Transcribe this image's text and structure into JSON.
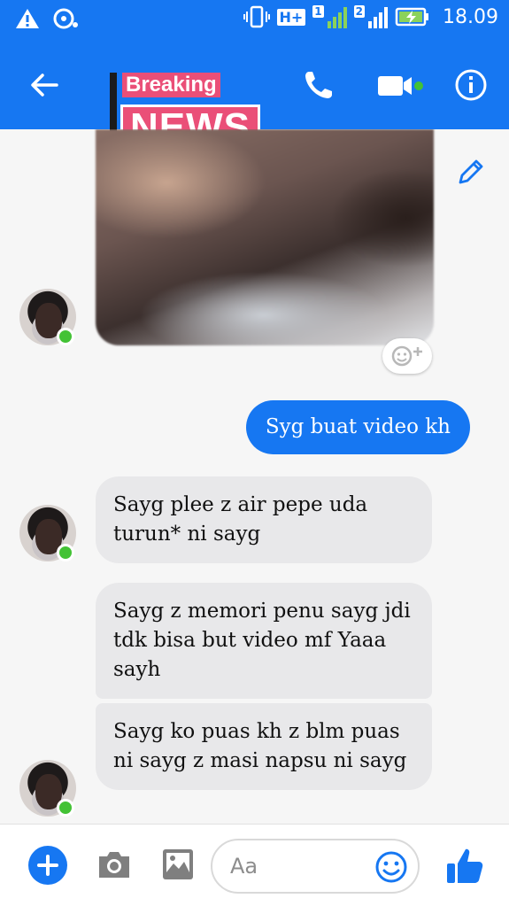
{
  "status_bar": {
    "network_badge": "H+",
    "sim1": "1",
    "sim2": "2",
    "time": "18.09"
  },
  "header": {
    "overlay_top": "Breaking",
    "overlay_main": "NEWS"
  },
  "composer": {
    "placeholder": "Aa"
  },
  "messages": [
    {
      "direction": "in",
      "type": "video"
    },
    {
      "direction": "out",
      "text": "Syg buat video kh"
    },
    {
      "direction": "in",
      "text": "Sayg plee z air pepe uda turun* ni sayg"
    },
    {
      "direction": "in",
      "text": "Sayg z memori penu sayg jdi tdk bisa but video mf Yaaa sayh"
    },
    {
      "direction": "in",
      "text": "Sayg ko puas kh z blm puas ni sayg z masi napsu ni sayg"
    }
  ],
  "icons": {
    "back": "arrow-left",
    "call": "phone",
    "video_call": "video-camera",
    "info": "info-circle",
    "edit": "pencil",
    "add": "plus",
    "camera": "camera",
    "gallery": "image",
    "emoji": "smiley",
    "like": "thumbs-up"
  },
  "colors": {
    "brand": "#1677f2",
    "online": "#43c235",
    "incoming_bubble": "#e8e8ea",
    "news_overlay": "#ea4f78"
  }
}
